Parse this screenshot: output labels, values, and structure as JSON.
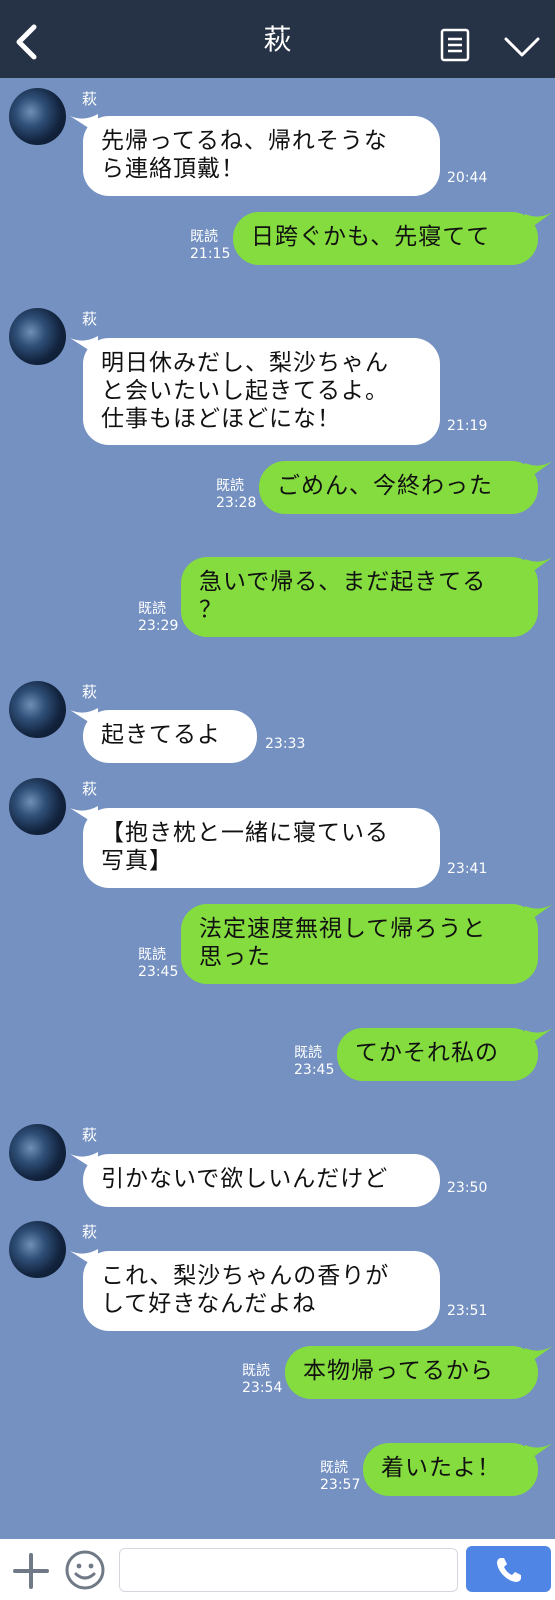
{
  "header": {
    "title": "萩"
  },
  "messages": [
    {
      "side": "in",
      "name": "萩",
      "lines": [
        "先帰ってるね、帰れそうな",
        "ら連絡頂戴！"
      ],
      "time": "20:44"
    },
    {
      "side": "out",
      "read": "既読",
      "lines": [
        "日跨ぐかも、先寝てて"
      ],
      "time": "21:15"
    },
    {
      "side": "in",
      "name": "萩",
      "lines": [
        "明日休みだし、梨沙ちゃん",
        "と会いたいし起きてるよ。",
        "仕事もほどほどにな！"
      ],
      "time": "21:19"
    },
    {
      "side": "out",
      "read": "既読",
      "lines": [
        "ごめん、今終わった"
      ],
      "time": "23:28"
    },
    {
      "side": "out",
      "read": "既読",
      "lines": [
        "急いで帰る、まだ起きてる",
        "？"
      ],
      "time": "23:29"
    },
    {
      "side": "in",
      "name": "萩",
      "lines": [
        "起きてるよ"
      ],
      "time": "23:33"
    },
    {
      "side": "in",
      "name": "萩",
      "lines": [
        "【抱き枕と一緒に寝ている",
        "写真】"
      ],
      "time": "23:41"
    },
    {
      "side": "out",
      "read": "既読",
      "lines": [
        "法定速度無視して帰ろうと",
        "思った"
      ],
      "time": "23:45"
    },
    {
      "side": "out",
      "read": "既読",
      "lines": [
        "てかそれ私の"
      ],
      "time": "23:45"
    },
    {
      "side": "in",
      "name": "萩",
      "lines": [
        "引かないで欲しいんだけど"
      ],
      "time": "23:50"
    },
    {
      "side": "in",
      "name": "萩",
      "lines": [
        "これ、梨沙ちゃんの香りが",
        "して好きなんだよね"
      ],
      "time": "23:51"
    },
    {
      "side": "out",
      "read": "既読",
      "lines": [
        "本物帰ってるから"
      ],
      "time": "23:54"
    },
    {
      "side": "out",
      "read": "既読",
      "lines": [
        "着いたよ！"
      ],
      "time": "23:57"
    }
  ],
  "footer": {
    "input_value": ""
  },
  "icons": {
    "back": "chevron-left-icon",
    "menu": "document-list-icon",
    "down": "chevron-down-icon",
    "plus": "plus-icon",
    "emoji": "smiley-icon",
    "call": "phone-icon"
  },
  "colors": {
    "background": "#7491c1",
    "header": "#263246",
    "incoming_bubble": "#ffffff",
    "outgoing_bubble": "#84dc3e",
    "call_button": "#4f86e6"
  }
}
